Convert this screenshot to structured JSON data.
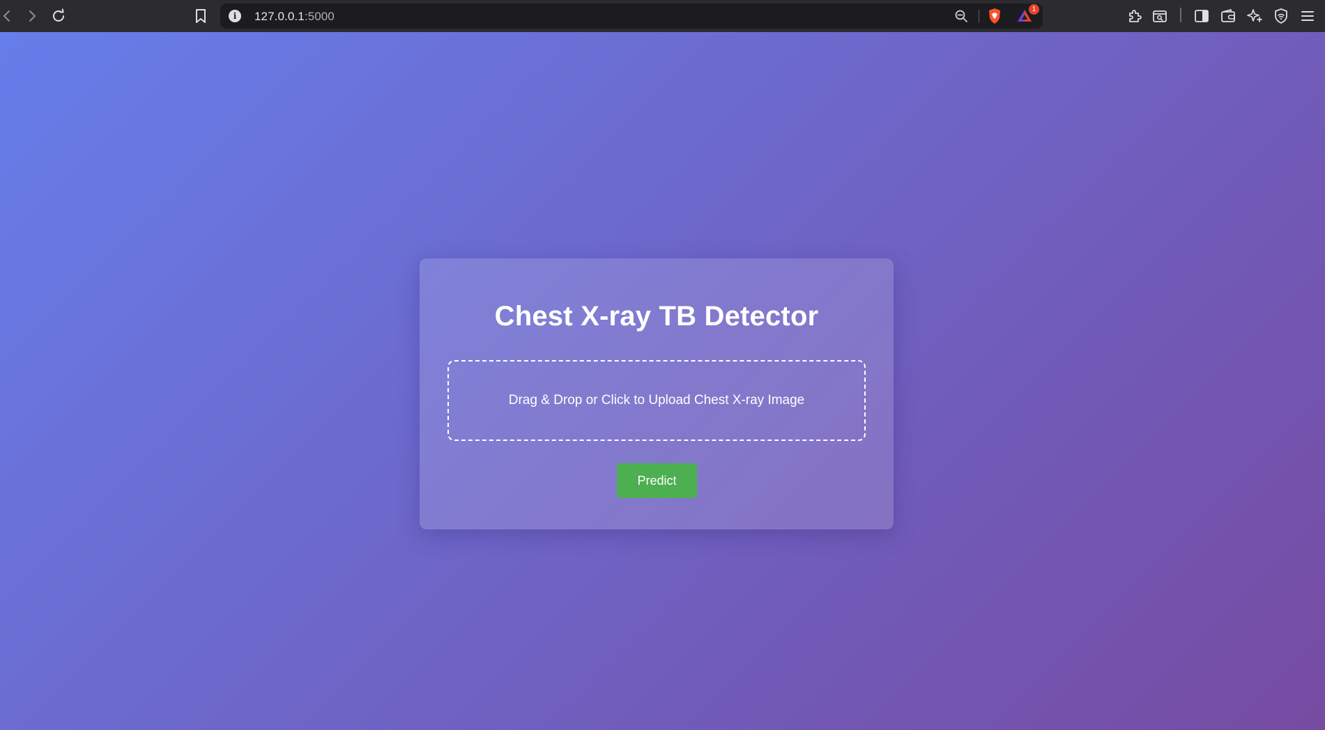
{
  "browser": {
    "url_host": "127.0.0.1",
    "url_port": ":5000",
    "notification_badge": "1",
    "brand_color": "#fb542b"
  },
  "app": {
    "title": "Chest X-ray TB Detector",
    "dropzone_text": "Drag & Drop or Click to Upload Chest X-ray Image",
    "predict_label": "Predict"
  },
  "colors": {
    "gradient_start": "#667eea",
    "gradient_end": "#764ba2",
    "button": "#4caf50"
  }
}
